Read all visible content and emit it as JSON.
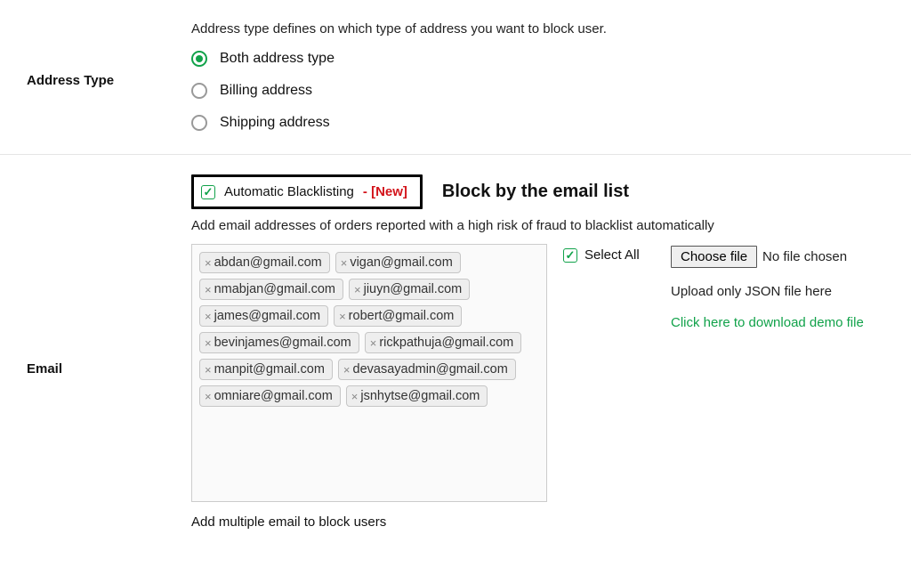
{
  "addressType": {
    "label": "Address Type",
    "hint": "Address type defines on which type of address you want to block user.",
    "options": {
      "both": {
        "label": "Both address type",
        "selected": true
      },
      "billing": {
        "label": "Billing address",
        "selected": false
      },
      "shipping": {
        "label": "Shipping address",
        "selected": false
      }
    }
  },
  "email": {
    "label": "Email",
    "autoBlacklist": {
      "checked": true,
      "label": "Automatic Blacklisting",
      "newTag": "- [New]"
    },
    "heading": "Block by the email list",
    "subHint": "Add email addresses of orders reported with a high risk of fraud to blacklist automatically",
    "tags": [
      "abdan@gmail.com",
      "vigan@gmail.com",
      "nmabjan@gmail.com",
      "jiuyn@gmail.com",
      "james@gmail.com",
      "robert@gmail.com",
      "bevinjames@gmail.com",
      "rickpathuja@gmail.com",
      "manpit@gmail.com",
      "devasayadmin@gmail.com",
      "omniare@gmail.com",
      "jsnhytse@gmail.com"
    ],
    "selectAll": {
      "label": "Select All",
      "checked": true
    },
    "file": {
      "buttonLabel": "Choose file",
      "statusText": "No file chosen",
      "note": "Upload only JSON file here",
      "demoLink": "Click here to download demo file"
    },
    "bottomHint": "Add multiple email to block users"
  }
}
